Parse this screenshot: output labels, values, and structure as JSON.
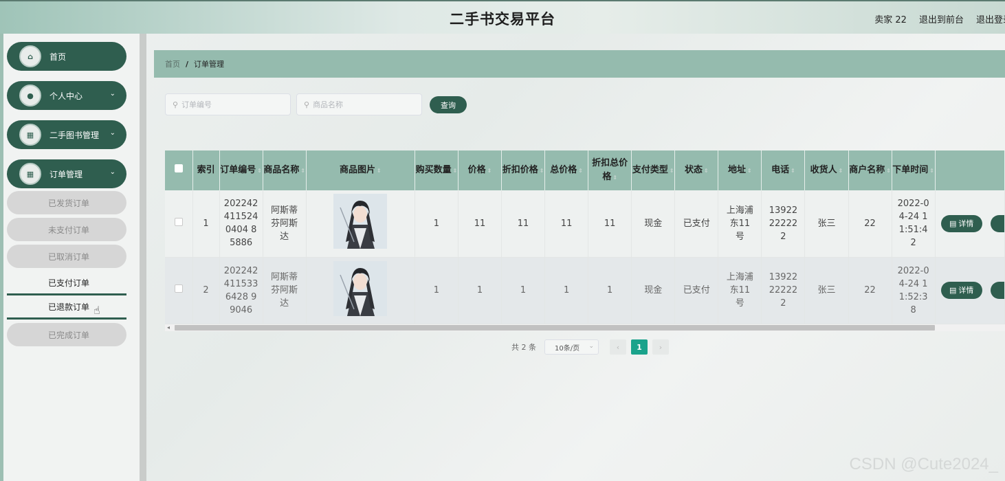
{
  "header": {
    "title": "二手书交易平台",
    "user": "卖家 22",
    "to_front": "退出到前台",
    "logout": "退出登录"
  },
  "sidebar": {
    "menu": [
      {
        "label": "首页",
        "icon": "home-icon"
      },
      {
        "label": "个人中心",
        "icon": "user-icon"
      },
      {
        "label": "二手图书管理",
        "icon": "grid-icon"
      },
      {
        "label": "订单管理",
        "icon": "grid-icon"
      }
    ],
    "submenu": [
      "已发货订单",
      "未支付订单",
      "已取消订单",
      "已支付订单",
      "已退款订单",
      "已完成订单"
    ]
  },
  "breadcrumb": {
    "home": "首页",
    "sep": "/",
    "current": "订单管理"
  },
  "search": {
    "order_placeholder": "订单编号",
    "product_placeholder": "商品名称",
    "query_label": "查询"
  },
  "table": {
    "headers": [
      "索引",
      "订单编号",
      "商品名称",
      "商品图片",
      "购买数量",
      "价格",
      "折扣价格",
      "总价格",
      "折扣总价格",
      "支付类型",
      "状态",
      "地址",
      "电话",
      "收货人",
      "商户名称",
      "下单时间"
    ],
    "rows": [
      {
        "index": "1",
        "order_no": "2022424115240404 85886",
        "product": "阿斯蒂芬阿斯达",
        "qty": "1",
        "price": "11",
        "disc_price": "11",
        "total": "11",
        "disc_total": "11",
        "pay_type": "现金",
        "status": "已支付",
        "address": "上海浦东11号",
        "phone": "13922222222",
        "receiver": "张三",
        "merchant": "22",
        "time": "2022-04-24 11:51:42",
        "detail": "详情"
      },
      {
        "index": "2",
        "order_no": "2022424115336428 99046",
        "product": "阿斯蒂芬阿斯达",
        "qty": "1",
        "price": "1",
        "disc_price": "1",
        "total": "1",
        "disc_total": "1",
        "pay_type": "现金",
        "status": "已支付",
        "address": "上海浦东11号",
        "phone": "13922222222",
        "receiver": "张三",
        "merchant": "22",
        "time": "2022-04-24 11:52:38",
        "detail": "详情"
      }
    ]
  },
  "pager": {
    "total": "共 2 条",
    "page_size": "10条/页",
    "current_page": "1",
    "prev": "‹",
    "next": "›"
  },
  "watermark": "CSDN @Cute2024_"
}
